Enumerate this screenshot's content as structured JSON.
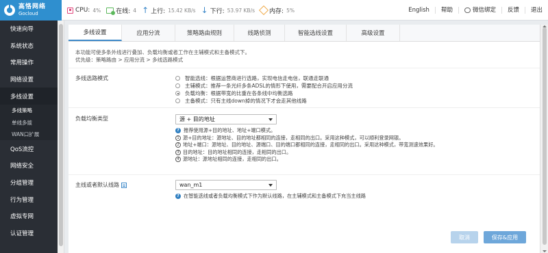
{
  "logo": {
    "name_cn": "高恪网络",
    "name_en": "Gocloud"
  },
  "stats": [
    {
      "icon": "cpu-icon",
      "label": "CPU:",
      "value": "4%"
    },
    {
      "icon": "online-icon",
      "label": "在线:",
      "value": "4"
    },
    {
      "icon": "upload-arrow-icon",
      "label": "上行:",
      "value": "15.42 KB/s"
    },
    {
      "icon": "download-arrow-icon",
      "label": "下行:",
      "value": "53.97 KB/s"
    },
    {
      "icon": "memory-icon",
      "label": "内存:",
      "value": "5%"
    }
  ],
  "topnav": {
    "language": "English",
    "help": "帮助",
    "wechat": "微信绑定",
    "feedback": "反馈",
    "logout": "退出"
  },
  "sidebar": {
    "items": [
      {
        "label": "快速向导"
      },
      {
        "label": "系统状态"
      },
      {
        "label": "常用操作"
      },
      {
        "label": "网络设置"
      },
      {
        "label": "多线设置"
      }
    ],
    "submenu": [
      {
        "label": "多线策略"
      },
      {
        "label": "单线多拨"
      },
      {
        "label": "WAN口扩展"
      }
    ],
    "items_after": [
      {
        "label": "QoS流控"
      },
      {
        "label": "网络安全"
      },
      {
        "label": "分组管理"
      },
      {
        "label": "行为管理"
      },
      {
        "label": "虚拟专网"
      },
      {
        "label": "认证管理"
      }
    ]
  },
  "tabs": [
    {
      "label": "多线设置"
    },
    {
      "label": "应用分流"
    },
    {
      "label": "策略路由规则"
    },
    {
      "label": "线路侦测"
    },
    {
      "label": "智能选线设置"
    },
    {
      "label": "高级设置"
    }
  ],
  "intro": {
    "line1": "本功能可使多条外线进行叠加、负载均衡或者工作在主辅模式和主备模式下。",
    "line2": "优先级：策略路由 > 应用分流 > 多线选路模式"
  },
  "mode": {
    "label": "多线选路模式",
    "options": [
      "智能选线：根据运营商进行选路，实现电信走电信，联通走联通",
      "主辅模式：推荐一条光纤多条ADSL的情形下使用，需要配合开启应用分流",
      "负载均衡：根据带宽的比重在各条线中均衡选路",
      "主备模式：只有主线down掉的情况下才会走其他线路"
    ],
    "selected_index": 2
  },
  "balance": {
    "label": "负载均衡类型",
    "selected": "源 + 目的地址",
    "help_lines": [
      {
        "num": "",
        "text": "推荐使用源+目的地址、地址+端口模式。"
      },
      {
        "num": "1",
        "text": "源+目的地址：源地址、目的地址都相同的连接，走相同的出口。采用这种模式，可以顺利登录网银。"
      },
      {
        "num": "2",
        "text": "地址+端口：源地址、目的地址、源端口、目的端口都相同的连接，走相同的出口。采用这种模式，带宽测速效果好。"
      },
      {
        "num": "3",
        "text": "目的地址：目的地址相同的连接，走相同的出口。"
      },
      {
        "num": "4",
        "text": "源地址：源地址相同的连接，走相同的出口。"
      }
    ]
  },
  "default_line": {
    "label": "主线或者默认线路",
    "selected": "wan_m1",
    "help": "在智能选线或者负载均衡模式下作为默认线路，在主辅模式和主备模式下充当主线路"
  },
  "buttons": {
    "cancel": "取消",
    "save": "保存&应用"
  }
}
